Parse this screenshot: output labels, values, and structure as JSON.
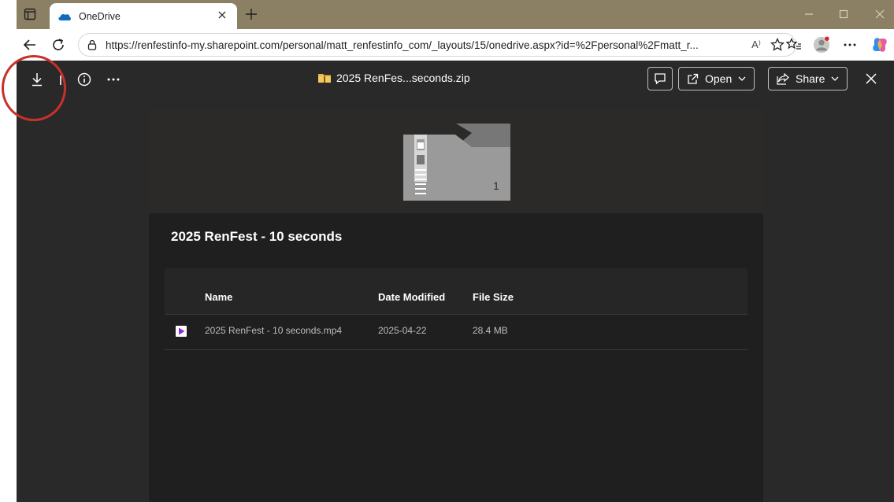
{
  "browser": {
    "tab_title": "OneDrive",
    "url": "https://renfestinfo-my.sharepoint.com/personal/matt_renfestinfo_com/_layouts/15/onedrive.aspx?id=%2Fpersonal%2Fmatt_r...",
    "read_aloud_label": "A⁾"
  },
  "viewer": {
    "file_name": "2025 RenFes...seconds.zip",
    "open_label": "Open",
    "share_label": "Share"
  },
  "zip_preview": {
    "count_badge": "1"
  },
  "archive": {
    "title": "2025 RenFest - 10 seconds",
    "columns": [
      "Name",
      "Date Modified",
      "File Size"
    ],
    "rows": [
      {
        "name": "2025 RenFest - 10 seconds.mp4",
        "date": "2025-04-22",
        "size": "28.4 MB"
      }
    ]
  },
  "colors": {
    "tabbar": "#8b7f64",
    "viewer_bg": "#292929",
    "panel_bg": "#1f1f1f",
    "annotation": "#c8312a",
    "video_icon": "#8a2be2"
  }
}
